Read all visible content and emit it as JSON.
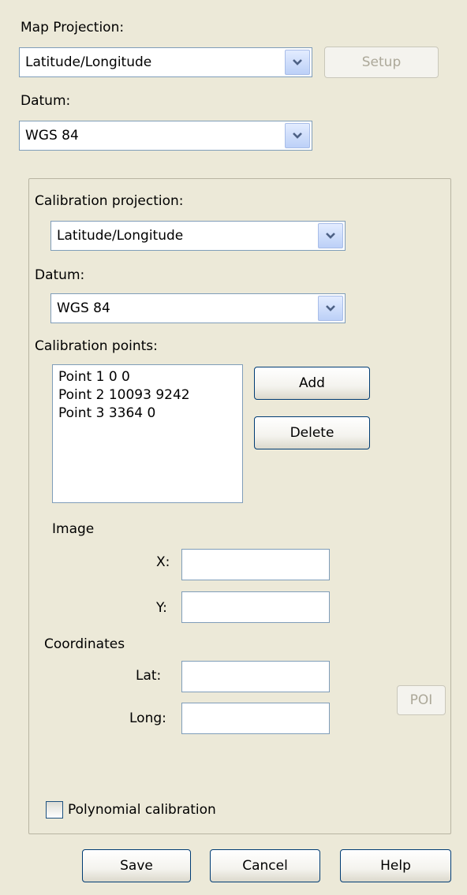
{
  "map_projection": {
    "label": "Map Projection:",
    "selected": "Latitude/Longitude",
    "setup_label": "Setup"
  },
  "datum": {
    "label": "Datum:",
    "selected": "WGS 84"
  },
  "calibration": {
    "projection_label": "Calibration projection:",
    "projection_selected": "Latitude/Longitude",
    "datum_label": "Datum:",
    "datum_selected": "WGS 84",
    "points_label": "Calibration points:",
    "points": [
      "Point 1 0 0",
      "Point 2 10093 9242",
      "Point 3 3364 0"
    ],
    "add_label": "Add",
    "delete_label": "Delete",
    "image_label": "Image",
    "x_label": "X:",
    "x_value": "",
    "y_label": "Y:",
    "y_value": "",
    "coordinates_label": "Coordinates",
    "lat_label": "Lat:",
    "lat_value": "",
    "long_label": "Long:",
    "long_value": "",
    "poi_label": "POI",
    "polynomial_label": "Polynomial calibration",
    "polynomial_checked": false
  },
  "footer": {
    "save_label": "Save",
    "cancel_label": "Cancel",
    "help_label": "Help"
  },
  "colors": {
    "background": "#ece9d8",
    "button_border": "#003c74",
    "field_border": "#7f9db9"
  }
}
